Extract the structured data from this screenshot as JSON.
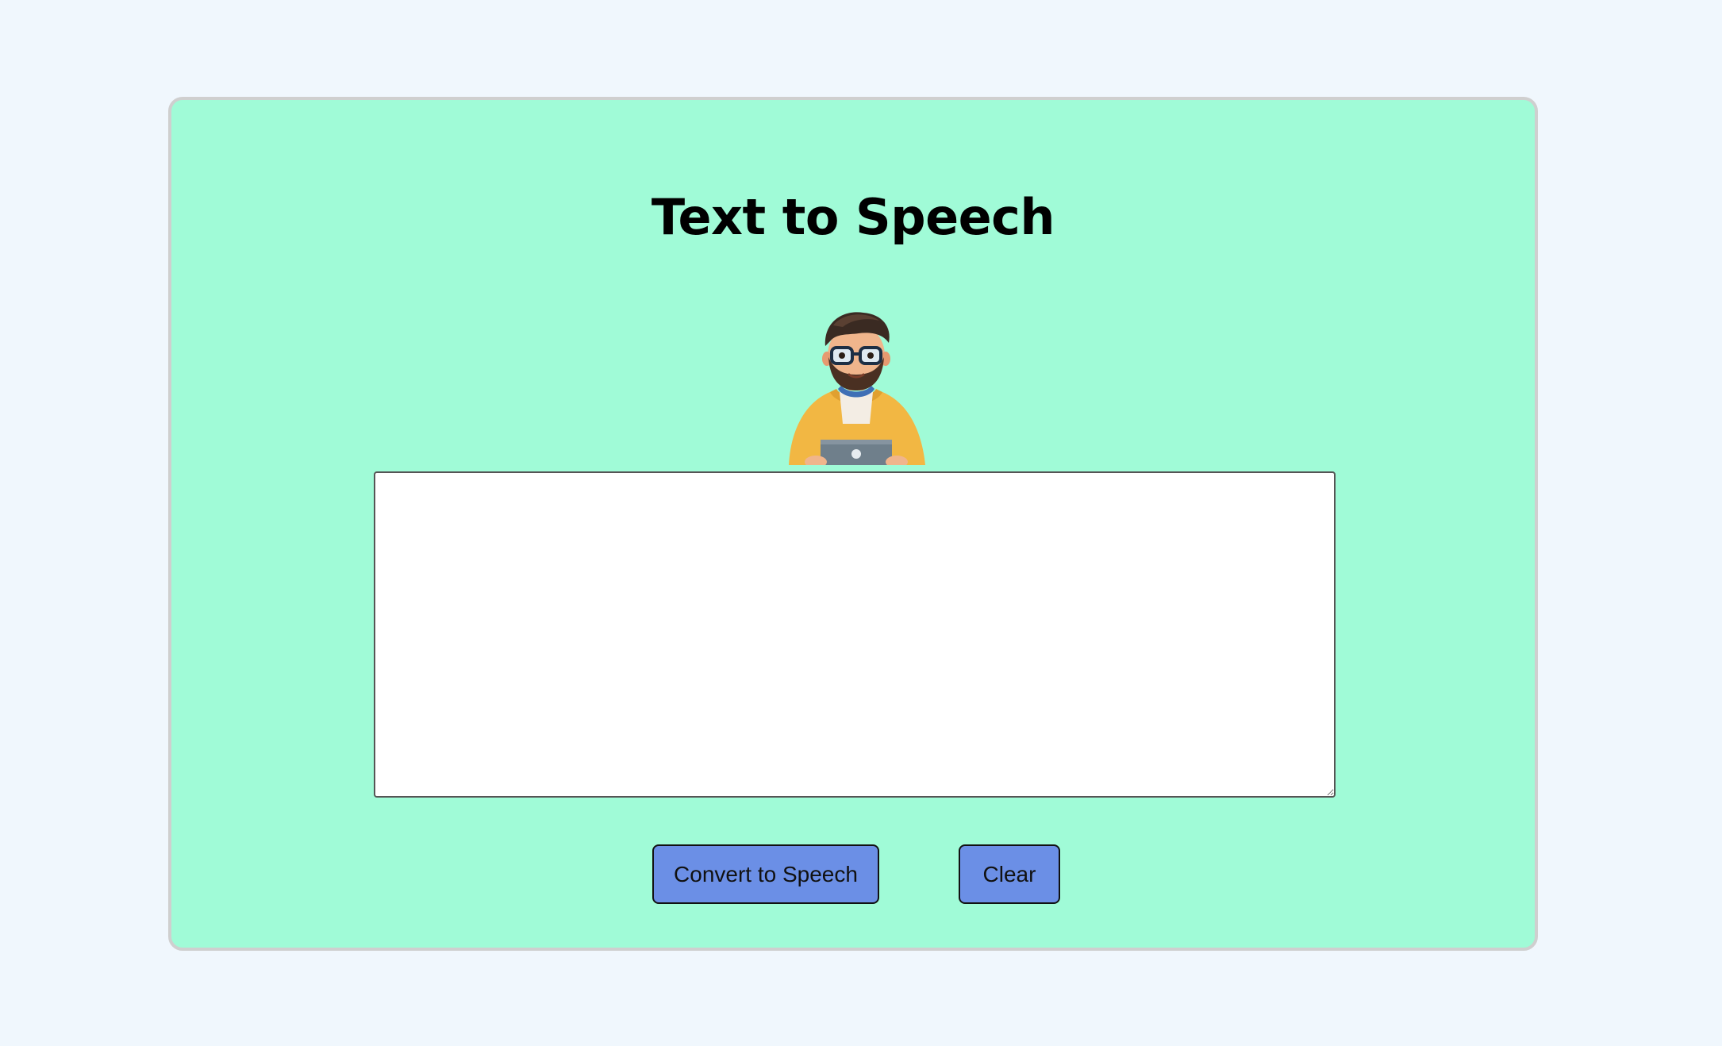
{
  "page": {
    "title": "Text to Speech"
  },
  "avatar": {
    "icon": "developer-avatar-icon"
  },
  "input": {
    "value": "",
    "placeholder": ""
  },
  "actions": {
    "convert_label": "Convert to Speech",
    "clear_label": "Clear"
  },
  "colors": {
    "background": "#f0f7fd",
    "card": "#a0fbd7",
    "button": "#6b8fe6"
  }
}
